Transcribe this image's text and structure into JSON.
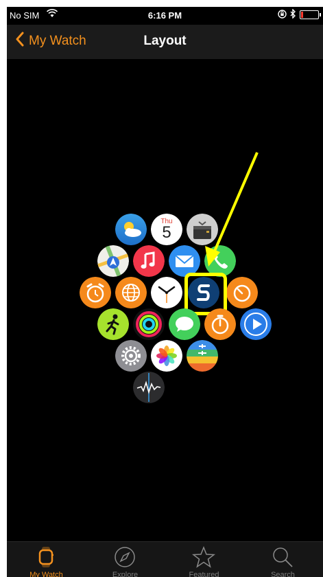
{
  "status_bar": {
    "carrier": "No SIM",
    "time": "6:16 PM"
  },
  "nav": {
    "back_label": "My Watch",
    "title": "Layout"
  },
  "apps": {
    "calendar_day": "Thu",
    "calendar_date": "5"
  },
  "tabs": [
    {
      "label": "My Watch",
      "icon": "watch-icon",
      "active": true
    },
    {
      "label": "Explore",
      "icon": "compass-icon",
      "active": false
    },
    {
      "label": "Featured",
      "icon": "star-icon",
      "active": false
    },
    {
      "label": "Search",
      "icon": "search-icon",
      "active": false
    }
  ],
  "colors": {
    "accent": "#f4911e",
    "highlight": "#ffff00"
  }
}
